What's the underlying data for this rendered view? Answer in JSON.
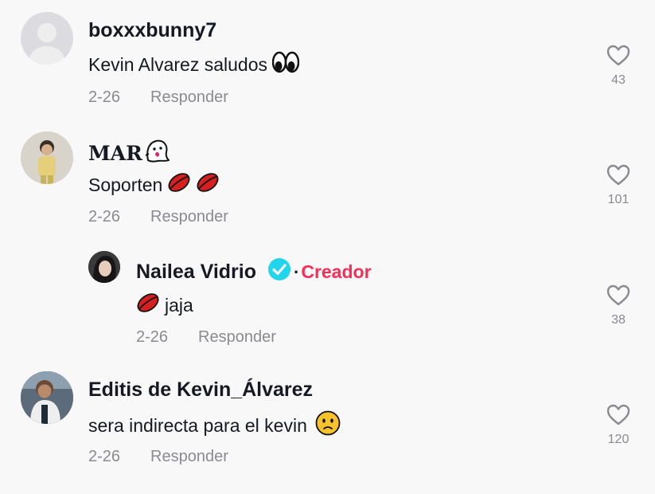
{
  "comments": [
    {
      "username": "boxxxbunny7",
      "text": "Kevin Alvarez saludos",
      "text_emoji": "eyes-emoji",
      "date": "2-26",
      "reply_label": "Responder",
      "likes": "43"
    },
    {
      "username": "MAR",
      "username_emoji": "ghost-emoji",
      "text": "Soporten",
      "text_emoji": "kiss-lips-emoji",
      "date": "2-26",
      "reply_label": "Responder",
      "likes": "101"
    },
    {
      "username": "Nailea Vidrio",
      "is_reply": true,
      "verified": true,
      "creator_badge": "Creador",
      "text": "jaja",
      "text_emoji": "kiss-lips-emoji",
      "date": "2-26",
      "reply_label": "Responder",
      "likes": "38"
    },
    {
      "username": "Editis de Kevin_Álvarez",
      "text": "sera indirecta para el kevin",
      "text_emoji": "worried-face-emoji",
      "date": "2-26",
      "reply_label": "Responder",
      "likes": "120"
    }
  ],
  "colors": {
    "creator": "#fe2c55",
    "verified": "#20d5ec",
    "muted": "#8a8b91",
    "text": "#161823"
  }
}
